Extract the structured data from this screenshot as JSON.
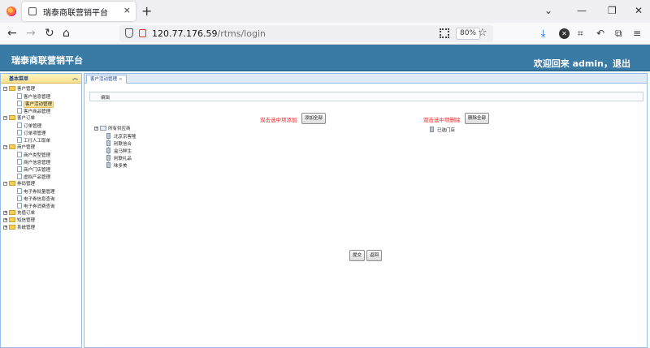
{
  "browser": {
    "tab_title": "瑞泰商联营销平台",
    "tab_close": "×",
    "new_tab": "+",
    "url_host": "120.77.176.59",
    "url_path": "/rtms/login",
    "zoom": "80%"
  },
  "app": {
    "title": "瑞泰商联营销平台",
    "welcome": "欢迎回来 admin，退出"
  },
  "sidebar": {
    "header": "基本菜单",
    "groups": [
      {
        "label": "客户管理",
        "items": [
          "客户信息管理",
          "客户活动管理",
          "客户商品管理"
        ]
      },
      {
        "label": "客户订单",
        "items": [
          "订单管理",
          "订单项管理",
          "工行人工取单"
        ]
      },
      {
        "label": "商户管理",
        "items": [
          "商户类型管理",
          "商户信息管理",
          "商户门店管理",
          "虚拟产品管理"
        ]
      },
      {
        "label": "券码管理",
        "items": [
          "电子券批量管理",
          "电子券信息查询",
          "电子券消费查询"
        ]
      },
      {
        "label": "充值订单",
        "items": []
      },
      {
        "label": "短信管理",
        "items": []
      },
      {
        "label": "系统管理",
        "items": []
      }
    ]
  },
  "content": {
    "tab_label": "客户活动管理",
    "tab_close": "×",
    "panel_title": "编辑",
    "left_hint": "双击选中项添加",
    "add_all_label": "添加全部",
    "right_hint": "双击选中项删除",
    "remove_all_label": "删除全部",
    "source_tree": {
      "root": "所有供应商",
      "children": [
        "北京京客隆",
        "利联信合",
        "盒马鲜生",
        "利联礼品",
        "味多美"
      ]
    },
    "selected_tree": {
      "items": [
        "已选门店"
      ]
    },
    "submit_label": "提交",
    "back_label": "返回"
  }
}
